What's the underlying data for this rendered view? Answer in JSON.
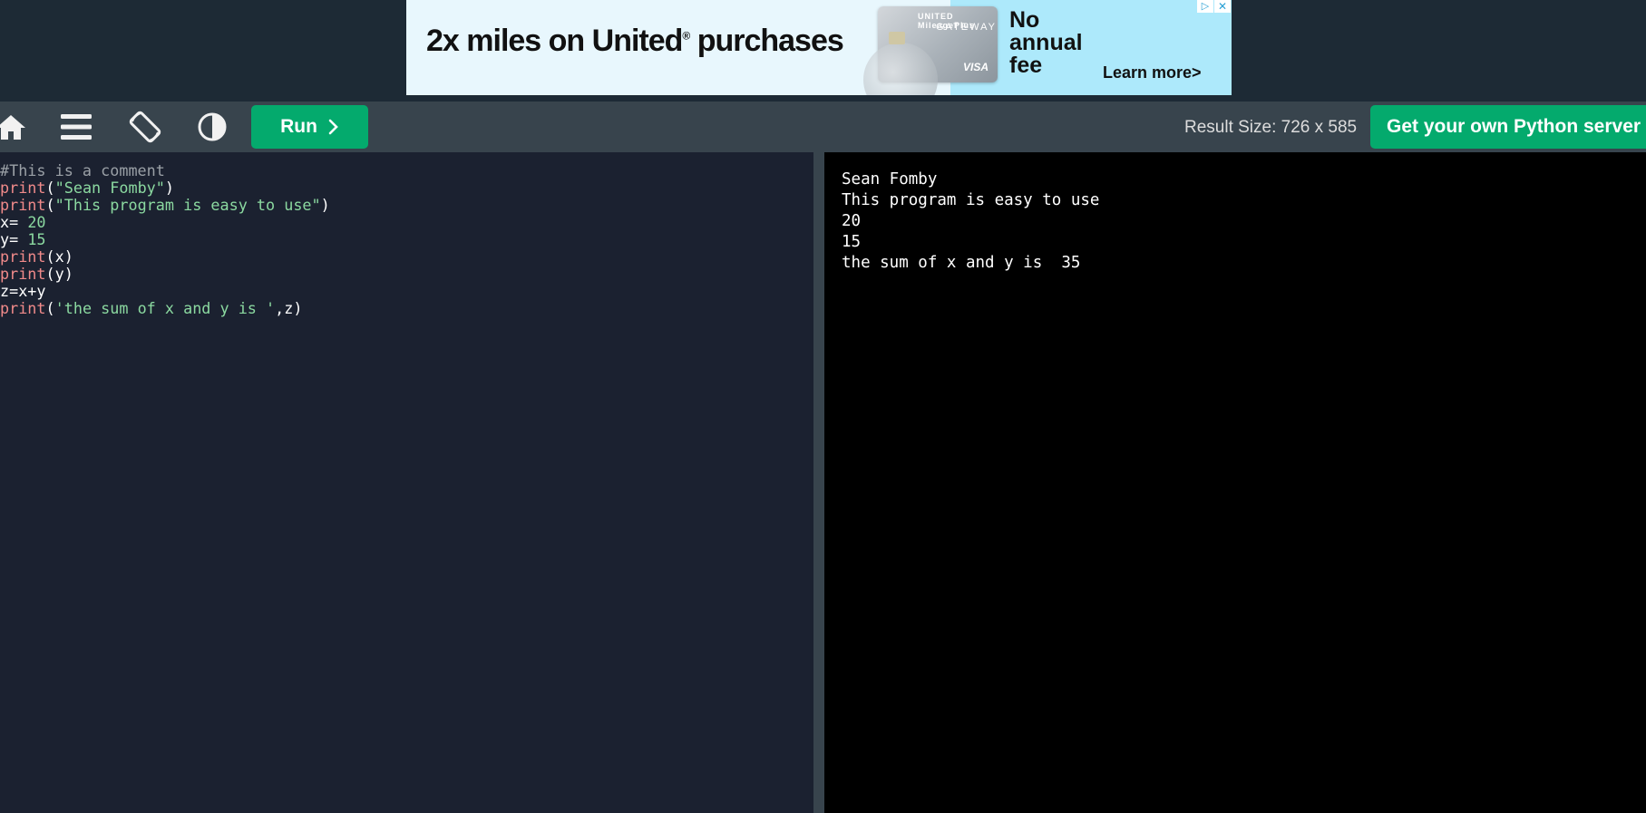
{
  "ad": {
    "headline": "2x miles on United",
    "headline_suffix": " purchases",
    "registered_mark": "®",
    "card_brand_top": "UNITED MileagePlus",
    "card_brand_name": "GATEWAY",
    "card_network": "VISA",
    "offer_text": "No\nannual\nfee",
    "learn_more": "Learn more>",
    "adchoices_icon": "▷",
    "close_icon": "✕"
  },
  "toolbar": {
    "icons": [
      "home-icon",
      "menu-icon",
      "rotate-icon",
      "contrast-icon"
    ],
    "run_label": "Run",
    "result_size": "Result Size: 726 x 585",
    "server_button_label": "Get your own Python server"
  },
  "editor": {
    "lines": [
      [
        {
          "t": "#This is a comment",
          "c": "comment"
        }
      ],
      [
        {
          "t": "print",
          "c": "func"
        },
        {
          "t": "(",
          "c": "plain"
        },
        {
          "t": "\"Sean Fomby\"",
          "c": "str"
        },
        {
          "t": ")",
          "c": "plain"
        }
      ],
      [
        {
          "t": "print",
          "c": "func"
        },
        {
          "t": "(",
          "c": "plain"
        },
        {
          "t": "\"This program is easy to use\"",
          "c": "str"
        },
        {
          "t": ")",
          "c": "plain"
        }
      ],
      [
        {
          "t": "x= ",
          "c": "plain"
        },
        {
          "t": "20",
          "c": "num"
        }
      ],
      [
        {
          "t": "y= ",
          "c": "plain"
        },
        {
          "t": "15",
          "c": "num"
        }
      ],
      [
        {
          "t": "print",
          "c": "func"
        },
        {
          "t": "(x)",
          "c": "plain"
        }
      ],
      [
        {
          "t": "print",
          "c": "func"
        },
        {
          "t": "(y)",
          "c": "plain"
        }
      ],
      [
        {
          "t": "z=x+y",
          "c": "plain"
        }
      ],
      [
        {
          "t": "print",
          "c": "func"
        },
        {
          "t": "(",
          "c": "plain"
        },
        {
          "t": "'the sum of x and y is '",
          "c": "str"
        },
        {
          "t": ",z)",
          "c": "plain"
        }
      ]
    ]
  },
  "output": {
    "lines": [
      "Sean Fomby",
      "This program is easy to use",
      "20",
      "15",
      "the sum of x and y is  35"
    ]
  }
}
